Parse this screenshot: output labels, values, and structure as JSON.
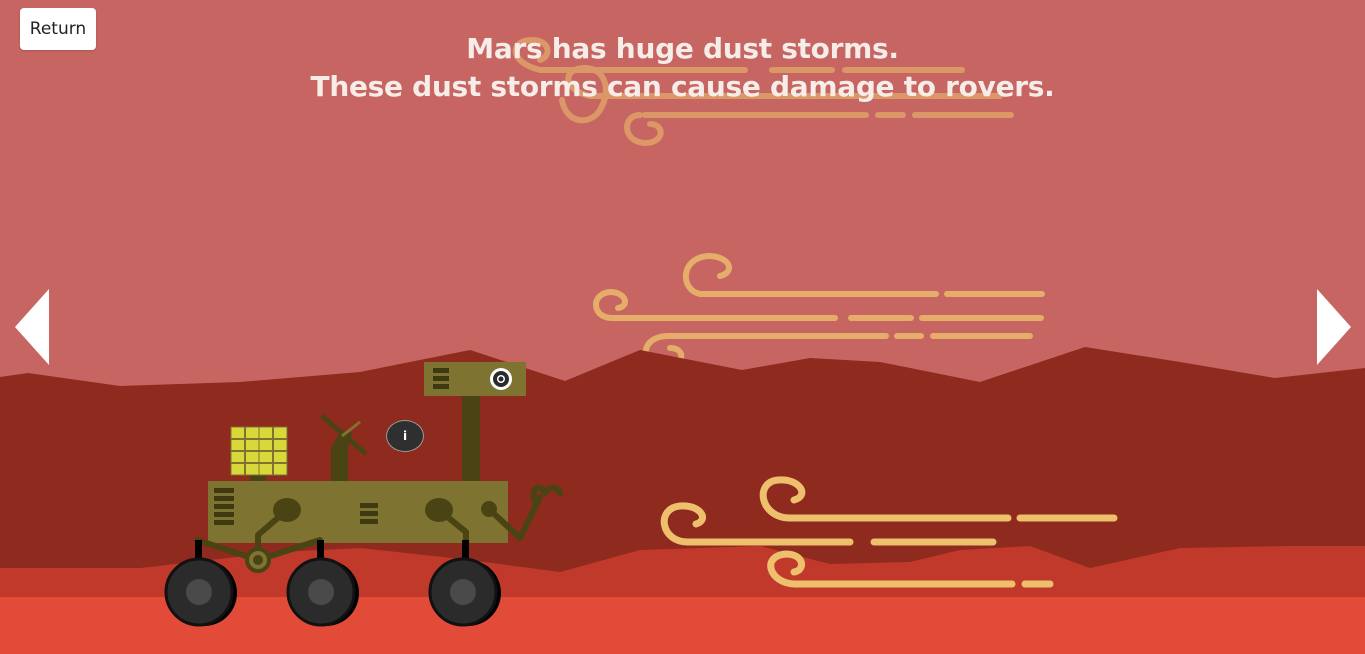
{
  "nav": {
    "return_label": "Return",
    "prev_icon": "triangle-left-icon",
    "next_icon": "triangle-right-icon"
  },
  "slide": {
    "line1": "Mars has huge dust storms.",
    "line2": "These dust storms can cause damage to rovers."
  },
  "info_button": {
    "label": "i"
  },
  "colors": {
    "sky": "#c66561",
    "mountains_far": "#8e2a1e",
    "hills_mid": "#c0392b",
    "ground": "#e34b39",
    "wind_faint": "#e0a06a",
    "wind_mid": "#e6ad6a",
    "wind_bright": "#eec06e",
    "rover_body": "#7e7330",
    "rover_arm": "#4a4414",
    "solar_panel": "#d8d83a",
    "wheel": "#2b2b2b"
  }
}
